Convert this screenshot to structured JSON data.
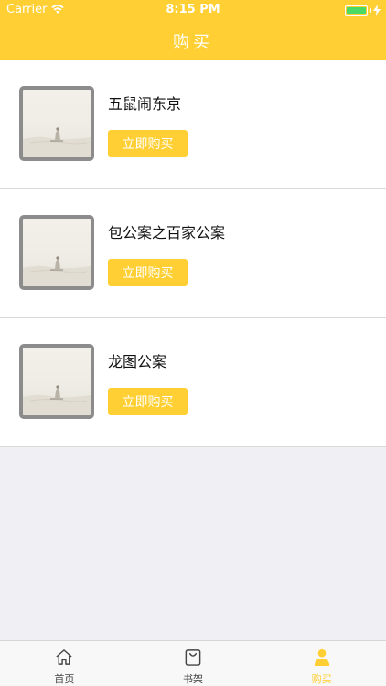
{
  "status_bar": {
    "carrier": "Carrier",
    "time": "8:15 PM",
    "battery_color": "#4cd964"
  },
  "nav": {
    "title": "购买",
    "background": "#ffcf33"
  },
  "books": [
    {
      "title": "五鼠闹东京",
      "button": "立即购买",
      "cover_icon": "landscape-cover"
    },
    {
      "title": "包公案之百家公案",
      "button": "立即购买",
      "cover_icon": "landscape-cover"
    },
    {
      "title": "龙图公案",
      "button": "立即购买",
      "cover_icon": "landscape-cover"
    }
  ],
  "tabbar": {
    "items": [
      {
        "label": "首页",
        "icon": "home-icon",
        "active": false
      },
      {
        "label": "书架",
        "icon": "bag-icon",
        "active": false
      },
      {
        "label": "购买",
        "icon": "person-icon",
        "active": true
      }
    ],
    "active_color": "#ffcf33"
  }
}
